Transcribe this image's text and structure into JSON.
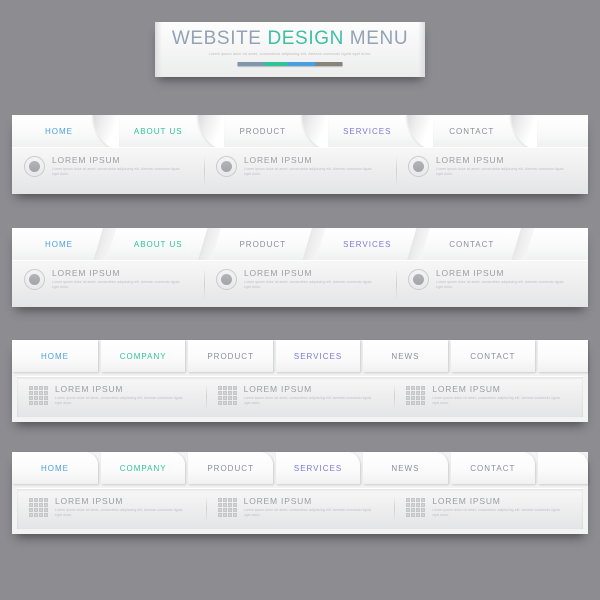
{
  "background_color": "#8c8c91",
  "header": {
    "title_parts": [
      {
        "text": "WEBSITE",
        "color": "#93a3b4"
      },
      {
        "text": "DESIGN",
        "color": "#3fbfa3"
      },
      {
        "text": "MENU",
        "color": "#93a3b4"
      }
    ],
    "subtitle": "Lorem ipsum dolor sit amet, consectetur adipiscing elit. Aenean commodo ligula eget dolor.",
    "accent_segments": [
      {
        "color": "#7f97ad",
        "width_pct": 26
      },
      {
        "color": "#2fc39a",
        "width_pct": 22
      },
      {
        "color": "#4a9fe0",
        "width_pct": 26
      },
      {
        "color": "#8b8377",
        "width_pct": 26
      }
    ]
  },
  "common": {
    "cell_title": "LOREM IPSUM",
    "cell_body": "Lorem ipsum dolor sit amet, consectetur adipiscing elit. Aenean commodo ligula eget dolor.",
    "circle_icon": "circle-bullet-icon",
    "grid_icon": "grid-squares-icon"
  },
  "menus": [
    {
      "id": "menu-curved-tabs",
      "style": "curved-separators",
      "items": [
        {
          "label": "HOME",
          "color": "#4a9fe0",
          "state": "link"
        },
        {
          "label": "ABOUT US",
          "color": "#2fc39a",
          "state": "active"
        },
        {
          "label": "PRODUCT",
          "color": "#8d8f94",
          "state": "link"
        },
        {
          "label": "SERVICES",
          "color": "#7b79d6",
          "state": "link"
        },
        {
          "label": "CONTACT",
          "color": "#8d8f94",
          "state": "link"
        }
      ],
      "cells": [
        {
          "icon": "circle-bullet-icon",
          "title": "LOREM IPSUM",
          "body": "Lorem ipsum dolor sit amet, consectetur adipiscing elit. Aenean commodo ligula eget dolor."
        },
        {
          "icon": "circle-bullet-icon",
          "title": "LOREM IPSUM",
          "body": "Lorem ipsum dolor sit amet, consectetur adipiscing elit. Aenean commodo ligula eget dolor."
        },
        {
          "icon": "circle-bullet-icon",
          "title": "LOREM IPSUM",
          "body": "Lorem ipsum dolor sit amet, consectetur adipiscing elit. Aenean commodo ligula eget dolor."
        }
      ]
    },
    {
      "id": "menu-slanted-tabs",
      "style": "slanted-separators",
      "items": [
        {
          "label": "HOME",
          "color": "#4a9fe0",
          "state": "link"
        },
        {
          "label": "ABOUT US",
          "color": "#2fc39a",
          "state": "active"
        },
        {
          "label": "PRODUCT",
          "color": "#8d8f94",
          "state": "link"
        },
        {
          "label": "SERVICES",
          "color": "#7b79d6",
          "state": "link"
        },
        {
          "label": "CONTACT",
          "color": "#8d8f94",
          "state": "link"
        }
      ],
      "cells": [
        {
          "icon": "circle-bullet-icon",
          "title": "LOREM IPSUM",
          "body": "Lorem ipsum dolor sit amet, consectetur adipiscing elit. Aenean commodo ligula eget dolor."
        },
        {
          "icon": "circle-bullet-icon",
          "title": "LOREM IPSUM",
          "body": "Lorem ipsum dolor sit amet, consectetur adipiscing elit. Aenean commodo ligula eget dolor."
        },
        {
          "icon": "circle-bullet-icon",
          "title": "LOREM IPSUM",
          "body": "Lorem ipsum dolor sit amet, consectetur adipiscing elit. Aenean commodo ligula eget dolor."
        }
      ]
    },
    {
      "id": "menu-square-blocks",
      "style": "square-blocks",
      "items": [
        {
          "label": "HOME",
          "color": "#4a9fe0",
          "state": "link"
        },
        {
          "label": "COMPANY",
          "color": "#2fc39a",
          "state": "active"
        },
        {
          "label": "PRODUCT",
          "color": "#8d8f94",
          "state": "link"
        },
        {
          "label": "SERVICES",
          "color": "#7b79d6",
          "state": "link"
        },
        {
          "label": "NEWS",
          "color": "#8d8f94",
          "state": "link"
        },
        {
          "label": "CONTACT",
          "color": "#8d8f94",
          "state": "link"
        },
        {
          "label": "",
          "color": "#8d8f94",
          "state": "empty"
        }
      ],
      "cells": [
        {
          "icon": "grid-squares-icon",
          "title": "LOREM IPSUM",
          "body": "Lorem ipsum dolor sit amet, consectetur adipiscing elit. Aenean commodo ligula eget dolor."
        },
        {
          "icon": "grid-squares-icon",
          "title": "LOREM IPSUM",
          "body": "Lorem ipsum dolor sit amet, consectetur adipiscing elit. Aenean commodo ligula eget dolor."
        },
        {
          "icon": "grid-squares-icon",
          "title": "LOREM IPSUM",
          "body": "Lorem ipsum dolor sit amet, consectetur adipiscing elit. Aenean commodo ligula eget dolor."
        }
      ]
    },
    {
      "id": "menu-rounded-blocks",
      "style": "rounded-blocks",
      "items": [
        {
          "label": "HOME",
          "color": "#4a9fe0",
          "state": "link"
        },
        {
          "label": "COMPANY",
          "color": "#2fc39a",
          "state": "active"
        },
        {
          "label": "PRODUCT",
          "color": "#8d8f94",
          "state": "link"
        },
        {
          "label": "SERVICES",
          "color": "#7b79d6",
          "state": "link"
        },
        {
          "label": "NEWS",
          "color": "#8d8f94",
          "state": "link"
        },
        {
          "label": "CONTACT",
          "color": "#8d8f94",
          "state": "link"
        },
        {
          "label": "",
          "color": "#8d8f94",
          "state": "empty"
        }
      ],
      "cells": [
        {
          "icon": "grid-squares-icon",
          "title": "LOREM IPSUM",
          "body": "Lorem ipsum dolor sit amet, consectetur adipiscing elit. Aenean commodo ligula eget dolor."
        },
        {
          "icon": "grid-squares-icon",
          "title": "LOREM IPSUM",
          "body": "Lorem ipsum dolor sit amet, consectetur adipiscing elit. Aenean commodo ligula eget dolor."
        },
        {
          "icon": "grid-squares-icon",
          "title": "LOREM IPSUM",
          "body": "Lorem ipsum dolor sit amet, consectetur adipiscing elit. Aenean commodo ligula eget dolor."
        }
      ]
    }
  ]
}
